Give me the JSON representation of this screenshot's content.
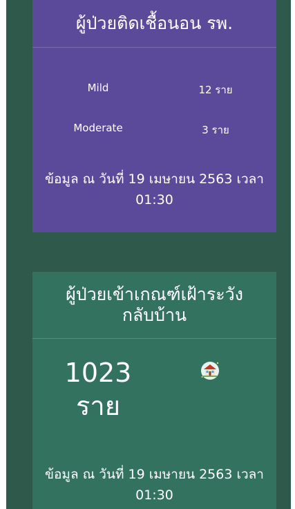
{
  "card_inpatient": {
    "title": "ผู้ป่วยติดเชื้อนอน รพ.",
    "rows": [
      {
        "label": "Mild",
        "value": "12 ราย"
      },
      {
        "label": "Moderate",
        "value": "3 ราย"
      }
    ],
    "note_line1": "ข้อมูล ณ วันที่ 19 เมษายน 2563 เวลา",
    "note_line2": "01:30"
  },
  "card_home_watch": {
    "title_line1": "ผู้ป่วยเข้าเกณฑ์เฝ้าระวัง",
    "title_line2": "กลับบ้าน",
    "count": "1023",
    "unit": "ราย",
    "icon": "house-icon",
    "note_line1": "ข้อมูล ณ วันที่ 19 เมษายน 2563 เวลา",
    "note_line2": "01:30"
  },
  "colors": {
    "background": "#2f5a4b",
    "purple_card": "#5b4a9a",
    "green_card": "#33725e"
  }
}
